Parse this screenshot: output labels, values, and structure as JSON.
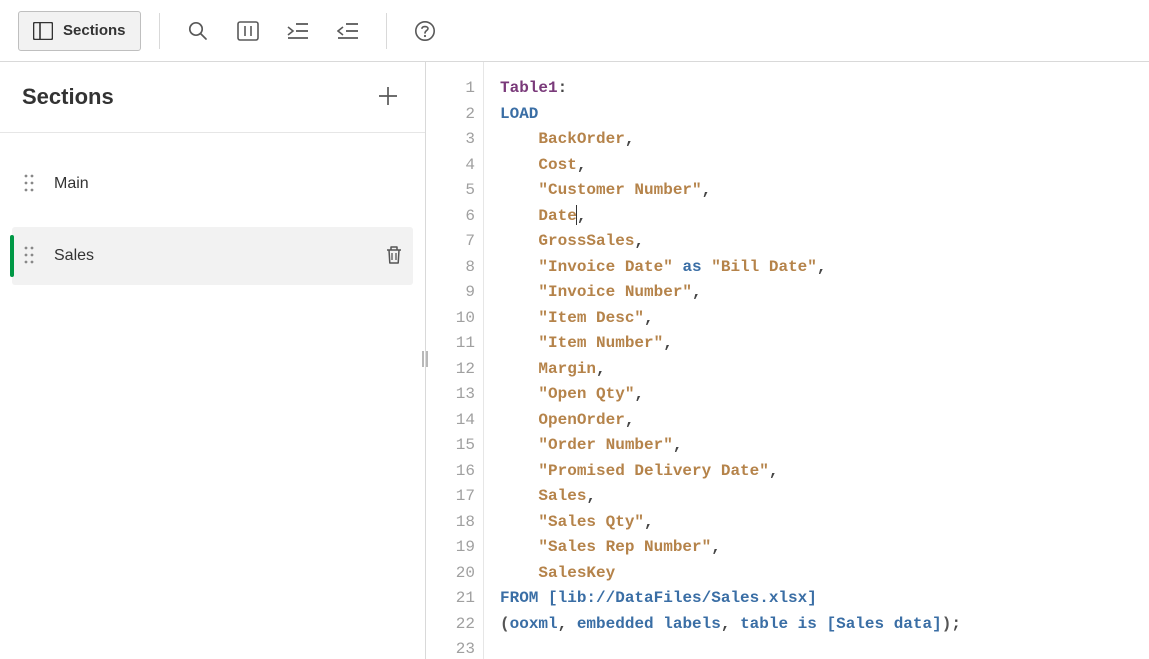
{
  "toolbar": {
    "sections_label": "Sections"
  },
  "sidebar": {
    "title": "Sections",
    "items": [
      {
        "label": "Main",
        "active": false
      },
      {
        "label": "Sales",
        "active": true
      }
    ]
  },
  "editor": {
    "tokens": [
      [
        {
          "t": "Table1",
          "c": "tablename"
        },
        {
          "t": ":",
          "c": "punct"
        }
      ],
      [
        {
          "t": "LOAD",
          "c": "keyword"
        }
      ],
      [
        {
          "t": "    ",
          "c": ""
        },
        {
          "t": "BackOrder",
          "c": "field"
        },
        {
          "t": ",",
          "c": "punct"
        }
      ],
      [
        {
          "t": "    ",
          "c": ""
        },
        {
          "t": "Cost",
          "c": "field"
        },
        {
          "t": ",",
          "c": "punct"
        }
      ],
      [
        {
          "t": "    ",
          "c": ""
        },
        {
          "t": "\"Customer Number\"",
          "c": "string"
        },
        {
          "t": ",",
          "c": "punct"
        }
      ],
      [
        {
          "t": "    ",
          "c": ""
        },
        {
          "t": "Date",
          "c": "field"
        },
        {
          "cursor": true
        },
        {
          "t": ",",
          "c": "punct"
        }
      ],
      [
        {
          "t": "    ",
          "c": ""
        },
        {
          "t": "GrossSales",
          "c": "field"
        },
        {
          "t": ",",
          "c": "punct"
        }
      ],
      [
        {
          "t": "    ",
          "c": ""
        },
        {
          "t": "\"Invoice Date\"",
          "c": "string"
        },
        {
          "t": " ",
          "c": ""
        },
        {
          "t": "as",
          "c": "keyword"
        },
        {
          "t": " ",
          "c": ""
        },
        {
          "t": "\"Bill Date\"",
          "c": "string"
        },
        {
          "t": ",",
          "c": "punct"
        }
      ],
      [
        {
          "t": "    ",
          "c": ""
        },
        {
          "t": "\"Invoice Number\"",
          "c": "string"
        },
        {
          "t": ",",
          "c": "punct"
        }
      ],
      [
        {
          "t": "    ",
          "c": ""
        },
        {
          "t": "\"Item Desc\"",
          "c": "string"
        },
        {
          "t": ",",
          "c": "punct"
        }
      ],
      [
        {
          "t": "    ",
          "c": ""
        },
        {
          "t": "\"Item Number\"",
          "c": "string"
        },
        {
          "t": ",",
          "c": "punct"
        }
      ],
      [
        {
          "t": "    ",
          "c": ""
        },
        {
          "t": "Margin",
          "c": "field"
        },
        {
          "t": ",",
          "c": "punct"
        }
      ],
      [
        {
          "t": "    ",
          "c": ""
        },
        {
          "t": "\"Open Qty\"",
          "c": "string"
        },
        {
          "t": ",",
          "c": "punct"
        }
      ],
      [
        {
          "t": "    ",
          "c": ""
        },
        {
          "t": "OpenOrder",
          "c": "field"
        },
        {
          "t": ",",
          "c": "punct"
        }
      ],
      [
        {
          "t": "    ",
          "c": ""
        },
        {
          "t": "\"Order Number\"",
          "c": "string"
        },
        {
          "t": ",",
          "c": "punct"
        }
      ],
      [
        {
          "t": "    ",
          "c": ""
        },
        {
          "t": "\"Promised Delivery Date\"",
          "c": "string"
        },
        {
          "t": ",",
          "c": "punct"
        }
      ],
      [
        {
          "t": "    ",
          "c": ""
        },
        {
          "t": "Sales",
          "c": "field"
        },
        {
          "t": ",",
          "c": "punct"
        }
      ],
      [
        {
          "t": "    ",
          "c": ""
        },
        {
          "t": "\"Sales Qty\"",
          "c": "string"
        },
        {
          "t": ",",
          "c": "punct"
        }
      ],
      [
        {
          "t": "    ",
          "c": ""
        },
        {
          "t": "\"Sales Rep Number\"",
          "c": "string"
        },
        {
          "t": ",",
          "c": "punct"
        }
      ],
      [
        {
          "t": "    ",
          "c": ""
        },
        {
          "t": "SalesKey",
          "c": "field"
        }
      ],
      [
        {
          "t": "FROM",
          "c": "keyword"
        },
        {
          "t": " ",
          "c": ""
        },
        {
          "t": "[lib://DataFiles/Sales.xlsx]",
          "c": "bracket"
        }
      ],
      [
        {
          "t": "(",
          "c": "symbol"
        },
        {
          "t": "ooxml",
          "c": "keyword"
        },
        {
          "t": ", ",
          "c": "punct"
        },
        {
          "t": "embedded labels",
          "c": "keyword"
        },
        {
          "t": ", ",
          "c": "punct"
        },
        {
          "t": "table is",
          "c": "keyword"
        },
        {
          "t": " ",
          "c": ""
        },
        {
          "t": "[Sales data]",
          "c": "bracket"
        },
        {
          "t": ")",
          "c": "symbol"
        },
        {
          "t": ";",
          "c": "punct"
        }
      ],
      []
    ]
  }
}
